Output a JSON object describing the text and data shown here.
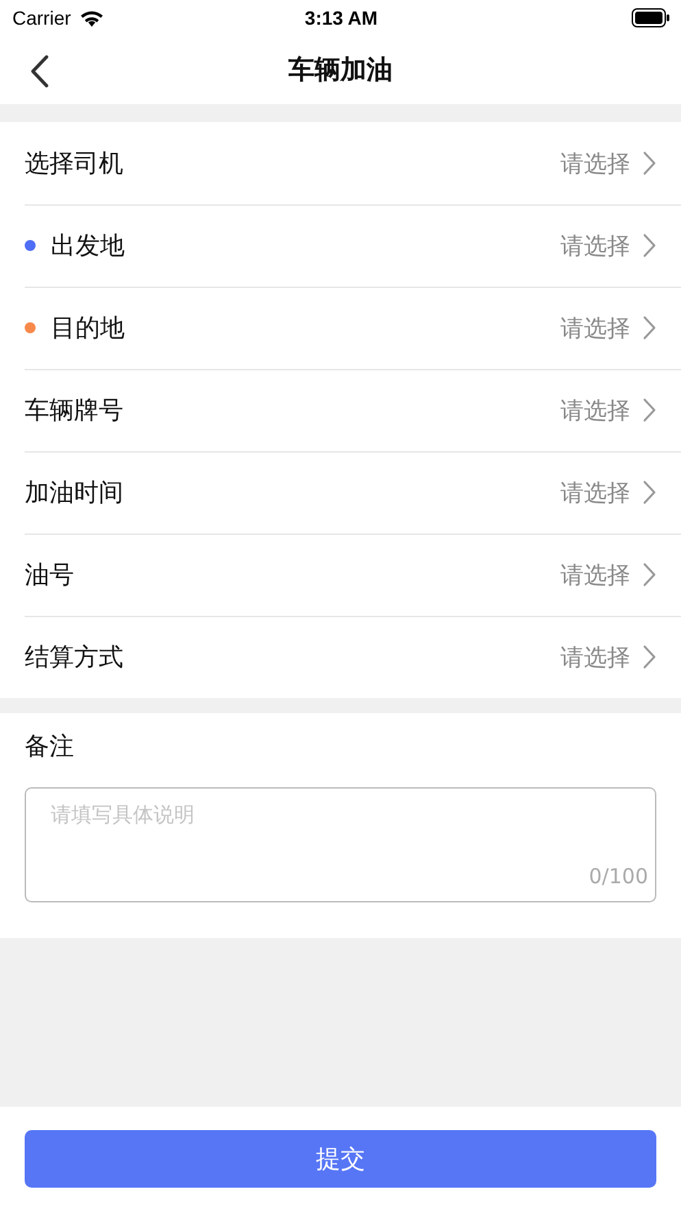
{
  "status_bar": {
    "carrier": "Carrier",
    "time": "3:13 AM"
  },
  "nav": {
    "title": "车辆加油"
  },
  "rows": [
    {
      "label": "选择司机",
      "value": "请选择"
    },
    {
      "label": "出发地",
      "value": "请选择",
      "color": "#4f6ef6"
    },
    {
      "label": "目的地",
      "value": "请选择",
      "color": "#f7894b"
    },
    {
      "label": "车辆牌号",
      "value": "请选择"
    },
    {
      "label": "加油时间",
      "value": "请选择"
    },
    {
      "label": "油号",
      "value": "请选择"
    },
    {
      "label": "结算方式",
      "value": "请选择"
    }
  ],
  "remark": {
    "label": "备注",
    "placeholder": "请填写具体说明",
    "counter": "0/100"
  },
  "submit": {
    "label": "提交"
  }
}
